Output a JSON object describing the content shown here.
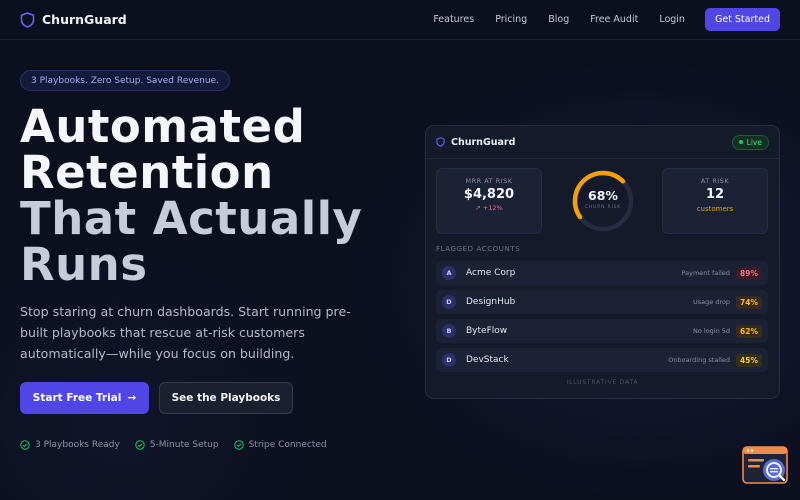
{
  "nav": {
    "brand": "ChurnGuard",
    "links": [
      "Features",
      "Pricing",
      "Blog",
      "Free Audit",
      "Login"
    ],
    "cta": "Get Started"
  },
  "hero": {
    "pill": "3 Playbooks. Zero Setup. Saved Revenue.",
    "headline_lines": [
      "Automated",
      "Retention",
      "That Actually",
      "Runs"
    ],
    "subtext": "Stop staring at churn dashboards. Start running pre-built playbooks that rescue at-risk customers automatically—while you focus on building.",
    "primary_cta": "Start Free Trial",
    "primary_cta_arrow": "→",
    "secondary_cta": "See the Playbooks",
    "checks": [
      "3 Playbooks Ready",
      "5-Minute Setup",
      "Stripe Connected"
    ]
  },
  "dashboard": {
    "title": "ChurnGuard",
    "status": "Live",
    "mrr": {
      "label": "MRR AT RISK",
      "value": "$4,820",
      "delta": "↗ +12%"
    },
    "churn": {
      "value": "68%",
      "label": "CHURN RISK",
      "percent": 68
    },
    "at_risk": {
      "label": "AT RISK",
      "value": "12",
      "unit": "customers"
    },
    "section_label": "FLAGGED ACCOUNTS",
    "accounts": [
      {
        "initial": "A",
        "name": "Acme Corp",
        "reason": "Payment failed",
        "pct": "89%"
      },
      {
        "initial": "D",
        "name": "DesignHub",
        "reason": "Usage drop",
        "pct": "74%"
      },
      {
        "initial": "B",
        "name": "ByteFlow",
        "reason": "No login 5d",
        "pct": "62%"
      },
      {
        "initial": "D",
        "name": "DevStack",
        "reason": "Onboarding stalled",
        "pct": "45%"
      }
    ],
    "footnote": "ILLUSTRATIVE DATA"
  },
  "icons": {
    "brand": "shield-icon",
    "check": "check-circle-icon",
    "widget": "chat-widget-icon"
  },
  "colors": {
    "accent": "#4f46e5",
    "gauge": "#f59e0b",
    "live": "#22c55e",
    "check": "#22c55e"
  }
}
